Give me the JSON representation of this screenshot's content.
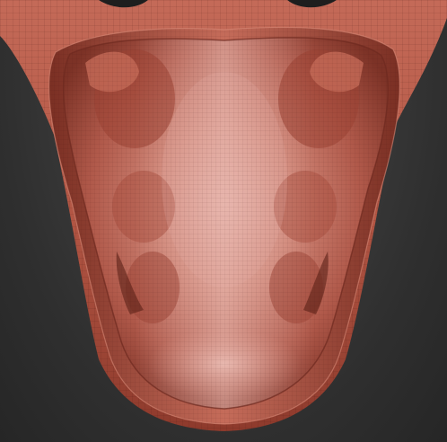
{
  "viewport": {
    "background": "#3a3a3a"
  },
  "model": {
    "clay_color": "#b85a48",
    "highlight_color": "#e3b0a8",
    "shadow_color": "#6e2a20",
    "wireframe_color": "#2b0d08"
  }
}
